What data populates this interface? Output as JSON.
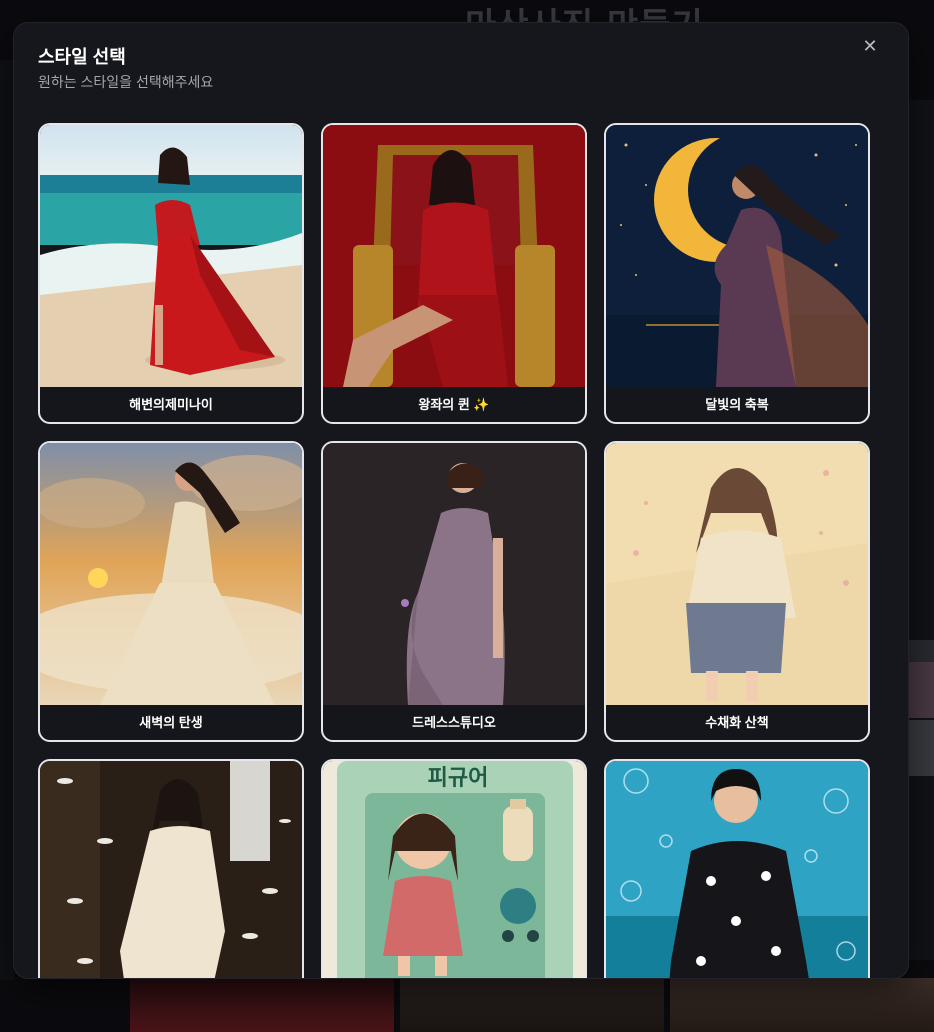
{
  "background": {
    "page_title": "마산사진 만들기"
  },
  "modal": {
    "title": "스타일 선택",
    "subtitle": "원하는 스타일을 선택해주세요",
    "close_icon": "close-icon",
    "close_glyph": "✕"
  },
  "styles": [
    {
      "label": "해변의제미나이",
      "image": "woman-red-dress-beach"
    },
    {
      "label": "왕좌의 퀸 ✨",
      "image": "woman-red-dress-throne"
    },
    {
      "label": "달빛의 축복",
      "image": "pregnant-woman-crescent-moon-night"
    },
    {
      "label": "새벽의 탄생",
      "image": "pregnant-woman-sunrise-clouds"
    },
    {
      "label": "드레스스튜디오",
      "image": "pregnant-woman-lilac-dress-studio"
    },
    {
      "label": "수채화 산책",
      "image": "watercolor-pregnant-woman-illustration"
    },
    {
      "label": "",
      "image": "pregnant-woman-lace-dress-feathers"
    },
    {
      "label": "",
      "image": "pregnant-figure-toy-box",
      "image_text": "피규어"
    },
    {
      "label": "",
      "image": "pregnant-woman-daisy-knit-bubbles"
    }
  ]
}
